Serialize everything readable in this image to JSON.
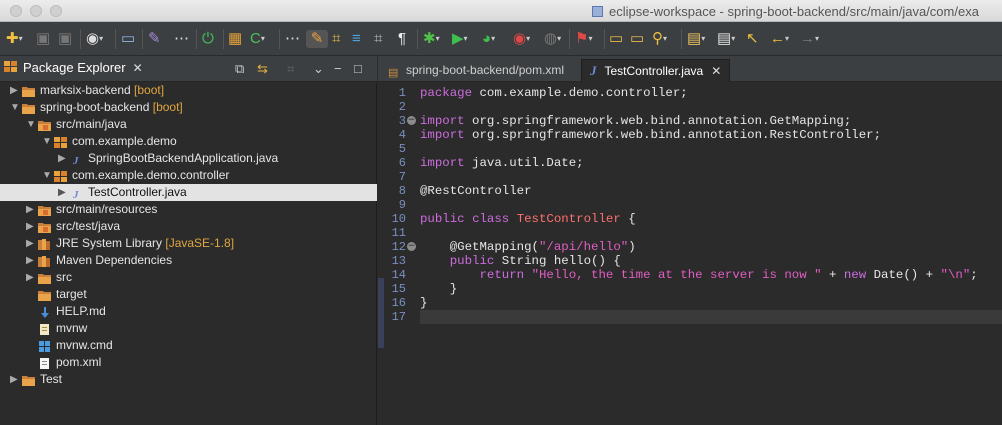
{
  "window": {
    "title": "eclipse-workspace - spring-boot-backend/src/main/java/com/exa"
  },
  "package_explorer": {
    "title": "Package Explorer",
    "close": "✕",
    "tree": [
      {
        "label": "marksix-backend",
        "deco": " [boot]",
        "twisty": "▶",
        "icon": "project-folder-icon"
      },
      {
        "label": "spring-boot-backend",
        "deco": " [boot]",
        "twisty": "▼",
        "icon": "project-folder-icon"
      },
      {
        "label": "src/main/java",
        "deco": "",
        "twisty": "▼",
        "icon": "source-folder-icon"
      },
      {
        "label": "com.example.demo",
        "deco": "",
        "twisty": "▼",
        "icon": "package-icon"
      },
      {
        "label": "SpringBootBackendApplication.java",
        "deco": "",
        "twisty": "▶",
        "icon": "java-file-icon"
      },
      {
        "label": "com.example.demo.controller",
        "deco": "",
        "twisty": "▼",
        "icon": "package-icon"
      },
      {
        "label": "TestController.java",
        "deco": "",
        "twisty": "▶",
        "icon": "java-file-icon"
      },
      {
        "label": "src/main/resources",
        "deco": "",
        "twisty": "▶",
        "icon": "source-folder-icon"
      },
      {
        "label": "src/test/java",
        "deco": "",
        "twisty": "▶",
        "icon": "source-folder-icon"
      },
      {
        "label": "JRE System Library",
        "deco": " [JavaSE-1.8]",
        "twisty": "▶",
        "icon": "library-icon"
      },
      {
        "label": "Maven Dependencies",
        "deco": "",
        "twisty": "▶",
        "icon": "library-icon"
      },
      {
        "label": "src",
        "deco": "",
        "twisty": "▶",
        "icon": "folder-icon"
      },
      {
        "label": "target",
        "deco": "",
        "twisty": "",
        "icon": "folder-icon"
      },
      {
        "label": "HELP.md",
        "deco": "",
        "twisty": "",
        "icon": "markdown-file-icon"
      },
      {
        "label": "mvnw",
        "deco": "",
        "twisty": "",
        "icon": "text-file-icon"
      },
      {
        "label": "mvnw.cmd",
        "deco": "",
        "twisty": "",
        "icon": "windows-file-icon"
      },
      {
        "label": "pom.xml",
        "deco": "",
        "twisty": "",
        "icon": "xml-file-icon"
      },
      {
        "label": "Test",
        "deco": "",
        "twisty": "▶",
        "icon": "project-folder-icon"
      }
    ]
  },
  "editor": {
    "tabs": [
      {
        "label": "spring-boot-backend/pom.xml"
      },
      {
        "label": "TestController.java",
        "close": "✕"
      }
    ],
    "line_numbers": [
      "1",
      "2",
      "3",
      "4",
      "5",
      "6",
      "7",
      "8",
      "9",
      "10",
      "11",
      "12",
      "13",
      "14",
      "15",
      "16",
      "17"
    ],
    "code": [
      [
        {
          "t": "package",
          "c": "kw"
        },
        {
          "t": " com.example.demo.controller;"
        }
      ],
      [],
      [
        {
          "t": "import",
          "c": "kw"
        },
        {
          "t": " org.springframework.web.bind.annotation.GetMapping;"
        }
      ],
      [
        {
          "t": "import",
          "c": "kw"
        },
        {
          "t": " org.springframework.web.bind.annotation.RestController;"
        }
      ],
      [],
      [
        {
          "t": "import",
          "c": "kw"
        },
        {
          "t": " java.util.Date;"
        }
      ],
      [],
      [
        {
          "t": "@RestController",
          "c": "ann"
        }
      ],
      [],
      [
        {
          "t": "public",
          "c": "kw"
        },
        {
          "t": " "
        },
        {
          "t": "class",
          "c": "kw"
        },
        {
          "t": " "
        },
        {
          "t": "TestController",
          "c": "cls"
        },
        {
          "t": " {"
        }
      ],
      [],
      [
        {
          "t": "    @GetMapping(",
          "c": "ann"
        },
        {
          "t": "\"/api/hello\"",
          "c": "str"
        },
        {
          "t": ")"
        }
      ],
      [
        {
          "t": "    "
        },
        {
          "t": "public",
          "c": "kw"
        },
        {
          "t": " String hello() {"
        }
      ],
      [
        {
          "t": "        "
        },
        {
          "t": "return",
          "c": "kw"
        },
        {
          "t": " "
        },
        {
          "t": "\"Hello, the time at the server is now \"",
          "c": "str"
        },
        {
          "t": " + "
        },
        {
          "t": "new",
          "c": "kw"
        },
        {
          "t": " Date() + "
        },
        {
          "t": "\"\\n\"",
          "c": "str"
        },
        {
          "t": ";"
        }
      ],
      [
        {
          "t": "    }"
        }
      ],
      [
        {
          "t": "}"
        }
      ],
      []
    ],
    "fold_glyph": "⊖"
  }
}
